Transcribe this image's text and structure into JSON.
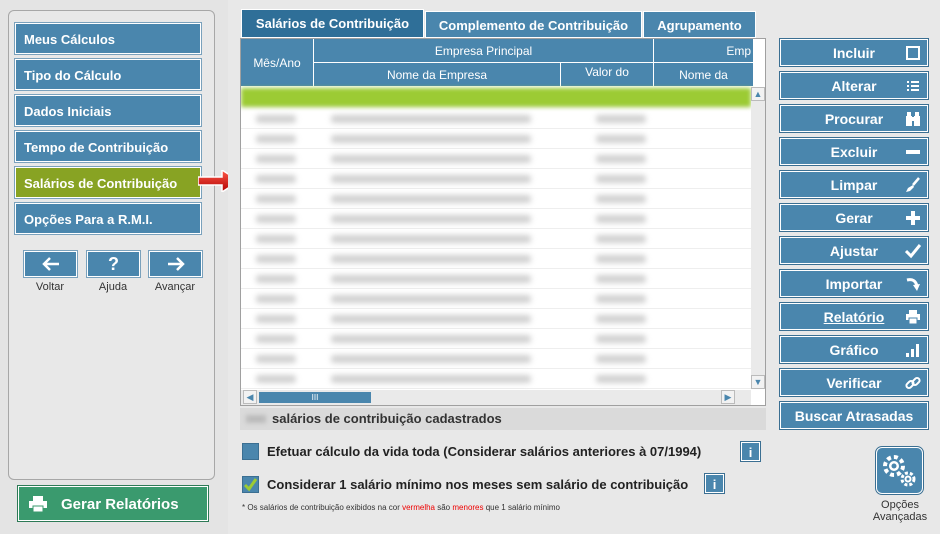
{
  "sidebar": {
    "items": [
      {
        "label": "Meus Cálculos"
      },
      {
        "label": "Tipo do Cálculo"
      },
      {
        "label": "Dados Iniciais"
      },
      {
        "label": "Tempo de Contribuição"
      },
      {
        "label": "Salários de Contribuição",
        "active": true
      },
      {
        "label": "Opções Para a R.M.I."
      }
    ],
    "nav": {
      "back": "Voltar",
      "help": "Ajuda",
      "forward": "Avançar",
      "help_symbol": "?"
    },
    "report_button": "Gerar Relatórios"
  },
  "tabs": [
    {
      "label": "Salários de Contribuição",
      "active": true
    },
    {
      "label": "Complemento de Contribuição"
    },
    {
      "label": "Agrupamento"
    }
  ],
  "grid": {
    "col_month": "Mês/Ano",
    "group_main": "Empresa Principal",
    "group_second": "Emp",
    "col_company_name": "Nome da Empresa",
    "col_value": "Valor do",
    "col_company_name2": "Nome da",
    "hscroll_thumb": "III"
  },
  "count_text": "salários de contribuição cadastrados",
  "options": {
    "lifetime": "Efetuar cálculo da vida toda (Considerar salários anteriores à 07/1994)",
    "min_salary": "Considerar 1 salário mínimo nos meses sem salário de contribuição",
    "info_symbol": "i"
  },
  "footnote": {
    "part1": "* Os salários de contribuição exibidos na cor",
    "red1": "vermelha",
    "part2": "são",
    "red2": "menores",
    "part3": "que 1 salário mínimo"
  },
  "actions": [
    {
      "label": "Incluir",
      "icon": "square-icon"
    },
    {
      "label": "Alterar",
      "icon": "list-icon"
    },
    {
      "label": "Procurar",
      "icon": "binoculars-icon"
    },
    {
      "label": "Excluir",
      "icon": "minus-icon"
    },
    {
      "label": "Limpar",
      "icon": "brush-icon"
    },
    {
      "label": "Gerar",
      "icon": "plus-icon"
    },
    {
      "label": "Ajustar",
      "icon": "check-icon"
    },
    {
      "label": "Importar",
      "icon": "curved-arrow-icon"
    },
    {
      "label": "Relatório",
      "icon": "printer-icon"
    },
    {
      "label": "Gráfico",
      "icon": "bar-chart-icon"
    },
    {
      "label": "Verificar",
      "icon": "link-icon"
    },
    {
      "label": "Buscar Atrasadas",
      "icon": ""
    }
  ],
  "advanced": {
    "line1": "Opções",
    "line2": "Avançadas"
  }
}
